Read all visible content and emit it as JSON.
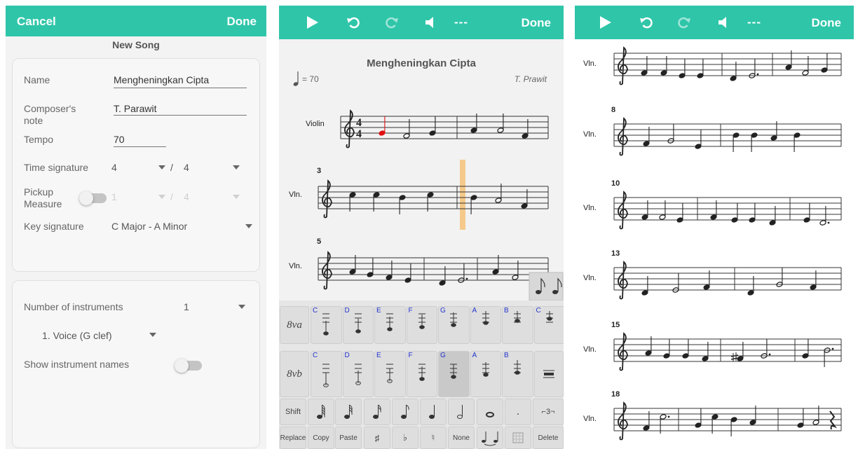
{
  "left_panel": {
    "cancel_label": "Cancel",
    "done_label": "Done",
    "screen_title": "New Song",
    "name_label": "Name",
    "name_value": "Mengheningkan Cipta",
    "composer_label": "Composer's note",
    "composer_value": "T. Parawit",
    "tempo_label": "Tempo",
    "tempo_value": "70",
    "time_sig_label": "Time signature",
    "time_sig_num": "4",
    "time_sig_sep": "/",
    "time_sig_den": "4",
    "pickup_label": "Pickup Measure",
    "pickup_num": "1",
    "pickup_sep": "/",
    "pickup_den": "4",
    "key_sig_label": "Key signature",
    "key_sig_value": "C Major - A Minor",
    "num_instruments_label": "Number of instruments",
    "num_instruments_value": "1",
    "instrument_item": "1.  Voice (G clef)",
    "show_names_label": "Show instrument names"
  },
  "middle_panel": {
    "done_label": "Done",
    "dash_label": "---",
    "score_title": "Mengheningkan Cipta",
    "tempo_mark": "= 70",
    "composer": "T. Prawit",
    "instrument_full": "Violin",
    "instrument_abbr": "Vln.",
    "measure_3": "3",
    "measure_5": "5",
    "ts_num": "4",
    "ts_den": "4",
    "keyboard": {
      "row1_labels": [
        "8va"
      ],
      "row2_labels": [
        "8vb"
      ],
      "note_letters_row1": [
        "C",
        "D",
        "E",
        "F",
        "G",
        "A",
        "B",
        "C"
      ],
      "note_letters_row2": [
        "C",
        "D",
        "E",
        "F",
        "G",
        "A",
        "B"
      ],
      "shift_label": "Shift",
      "replace_label": "Replace",
      "copy_label": "Copy",
      "paste_label": "Paste",
      "sharp_label": "♯",
      "flat_label": "♭",
      "natural_label": "♮",
      "none_label": "None",
      "delete_label": "Delete",
      "triplet_label": "⌐3¬",
      "dot_label": "."
    }
  },
  "right_panel": {
    "done_label": "Done",
    "dash_label": "---",
    "instrument_abbr": "Vln.",
    "measure_numbers": [
      "8",
      "10",
      "13",
      "15",
      "18"
    ]
  },
  "colors": {
    "accent": "#2fc5a9",
    "selected_note": "#e01010",
    "cursor": "#f4c98a",
    "note_letter": "#2233cc"
  }
}
